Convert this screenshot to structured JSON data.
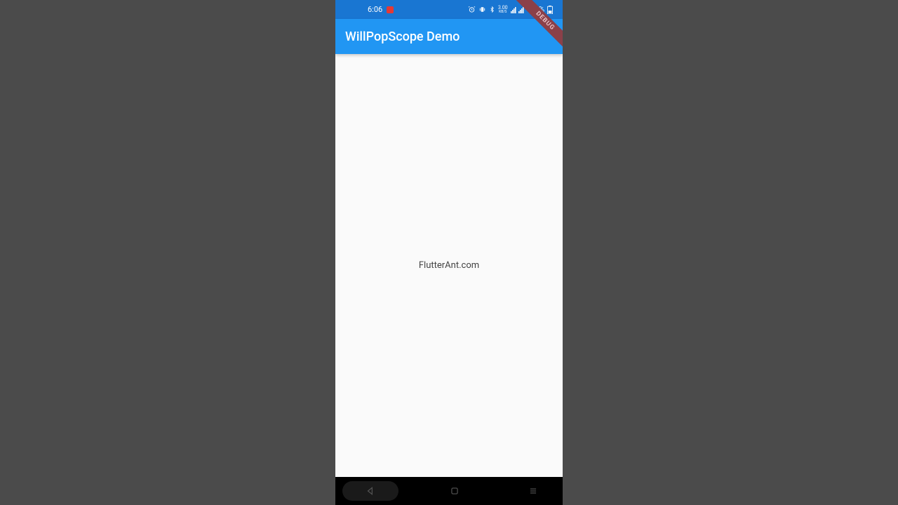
{
  "status": {
    "time": "6:06",
    "battery": "46%",
    "data_rate": "3.00",
    "data_unit": "KB/S"
  },
  "debug_banner": "DEBUG",
  "app_bar": {
    "title": "WillPopScope Demo"
  },
  "body": {
    "text": "FlutterAnt.com"
  }
}
